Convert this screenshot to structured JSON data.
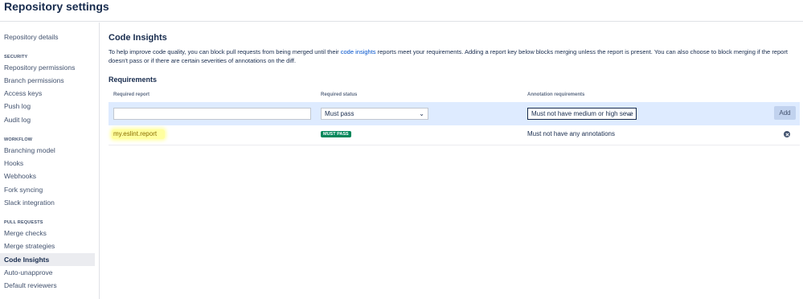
{
  "header": {
    "title": "Repository settings"
  },
  "sidebar": {
    "top_item": "Repository details",
    "groups": [
      {
        "label": "SECURITY",
        "items": [
          "Repository permissions",
          "Branch permissions",
          "Access keys",
          "Push log",
          "Audit log"
        ]
      },
      {
        "label": "WORKFLOW",
        "items": [
          "Branching model",
          "Hooks",
          "Webhooks",
          "Fork syncing",
          "Slack integration"
        ]
      },
      {
        "label": "PULL REQUESTS",
        "items": [
          "Merge checks",
          "Merge strategies",
          "Code Insights",
          "Auto-unapprove",
          "Default reviewers"
        ]
      }
    ],
    "active_item": "Code Insights"
  },
  "main": {
    "title": "Code Insights",
    "description_before": "To help improve code quality, you can block pull requests from being merged until their ",
    "description_link": "code insights",
    "description_after": " reports meet your requirements. Adding a report key below blocks merging unless the report is present. You can also choose to block merging if the report doesn't pass or if there are certain severities of annotations on the diff.",
    "requirements_title": "Requirements",
    "columns": {
      "report": "Required report",
      "status": "Required status",
      "annotation": "Annotation requirements"
    },
    "add_row": {
      "report_value": "",
      "status_value": "Must pass",
      "annotation_value": "Must not have medium or high seve",
      "add_label": "Add"
    },
    "rows": [
      {
        "report": "my.eslint.report",
        "status": "MUST PASS",
        "annotation": "Must not have any annotations"
      }
    ]
  },
  "colors": {
    "accent": "#0052cc",
    "badge_green": "#00875a",
    "row_highlight": "#deebff",
    "marker": "#ffff9e"
  },
  "icons": {
    "remove": "close-circle-icon",
    "dropdown": "chevron-down-icon"
  }
}
